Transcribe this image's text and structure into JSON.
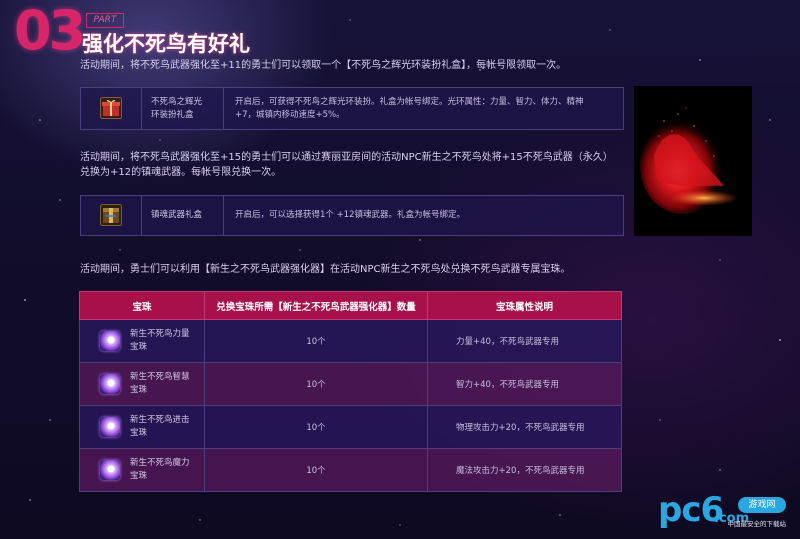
{
  "header": {
    "number": "03",
    "part": "PART",
    "title": "强化不死鸟有好礼"
  },
  "paragraphs": {
    "p1": "活动期间，将不死鸟武器强化至+11的勇士们可以领取一个【不死鸟之辉光环装扮礼盒】，每帐号限领取一次。",
    "p2_line1": "活动期间，将不死鸟武器强化至+15的勇士们可以通过赛丽亚房间的活动NPC新生之不死鸟处将+15不死鸟武器（永久）",
    "p2_line2": "兑换为+12的镇魂武器。每帐号限兑换一次。",
    "p3": "活动期间，勇士们可以利用【新生之不死鸟武器强化器】在活动NPC新生之不死鸟处兑换不死鸟武器专属宝珠。"
  },
  "reward1": {
    "icon": "gift-box-icon",
    "name_line1": "不死鸟之辉光",
    "name_line2": "环装扮礼盒",
    "desc_line1": "开启后，可获得不死鸟之辉光环装扮。礼盒为帐号绑定。光环属性：力量、智力、体力、精神",
    "desc_line2": "+7，城镇内移动速度+5%。"
  },
  "reward2": {
    "icon": "weapon-box-icon",
    "name": "镇魂武器礼盒",
    "desc": "开启后，可以选择获得1个 +12镇魂武器。礼盒为帐号绑定。"
  },
  "table": {
    "headers": [
      "宝珠",
      "兑换宝珠所需【新生之不死鸟武器强化器】数量",
      "宝珠属性说明"
    ],
    "rows": [
      {
        "name_line1": "新生不死鸟力量",
        "name_line2": "宝珠",
        "qty": "10个",
        "desc": "力量+40，不死鸟武器专用"
      },
      {
        "name_line1": "新生不死鸟智慧",
        "name_line2": "宝珠",
        "qty": "10个",
        "desc": "智力+40，不死鸟武器专用"
      },
      {
        "name_line1": "新生不死鸟进击",
        "name_line2": "宝珠",
        "qty": "10个",
        "desc": "物理攻击力+20，不死鸟武器专用"
      },
      {
        "name_line1": "新生不死鸟魔力",
        "name_line2": "宝珠",
        "qty": "10个",
        "desc": "魔法攻击力+20，不死鸟武器专用"
      }
    ]
  },
  "watermark": {
    "logo": "pc6",
    "badge": "游戏网",
    "domain": ".com",
    "tagline": "中国最安全的下载站"
  },
  "colors": {
    "accent": "#d8256a",
    "table_header": "#a8104a",
    "watermark": "#2aa7e0"
  }
}
